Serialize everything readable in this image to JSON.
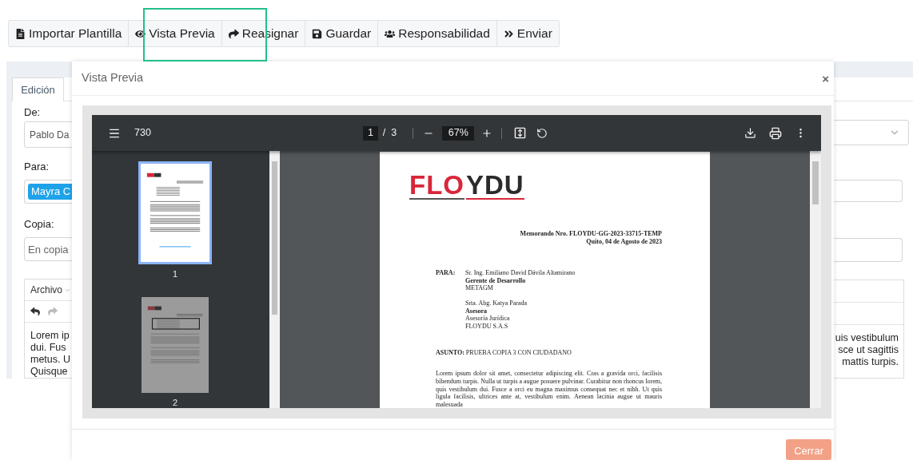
{
  "toolbar": {
    "buttons": [
      {
        "label": "Importar Plantilla"
      },
      {
        "label": "Vista Previa"
      },
      {
        "label": "Reasignar"
      },
      {
        "label": "Guardar"
      },
      {
        "label": "Responsabilidad"
      },
      {
        "label": "Enviar"
      }
    ]
  },
  "form": {
    "tab": {
      "label": "Edición",
      "selected": true
    },
    "from": {
      "label": "De:",
      "value": "Pablo Da"
    },
    "to": {
      "label": "Para:",
      "chip": "Mayra C"
    },
    "copy": {
      "label": "Copia:",
      "placeholder": "En copia"
    },
    "editor": {
      "menu": "Archivo",
      "text_left": [
        "Lorem ip",
        "dui. Fus",
        "metus. U",
        "Quisque"
      ],
      "text_right": [
        "uis vestibulum",
        "sce ut sagittis",
        "mattis turpis."
      ]
    }
  },
  "modal": {
    "title": "Vista Previa",
    "close": "×",
    "viewer": {
      "title": "730",
      "page": "1",
      "page_separator": "/",
      "page_count": "3",
      "zoom": "67%",
      "thumbnails": [
        {
          "label": "1",
          "selected": true
        },
        {
          "label": "2",
          "selected": false
        }
      ],
      "document": {
        "logo": [
          {
            "text": "FLO",
            "color": "#d9263a"
          },
          {
            "text": "YDU",
            "color": "#2b2b2b"
          }
        ],
        "memo_number": "Memorando Nro. FLOYDU-GG-2023-33715-TEMP",
        "date": "Quito, 04 de Agosto de 2023",
        "to_label": "PARA:",
        "recipients": [
          {
            "lines": [
              {
                "text": "Sr. Ing. Emiliano David Dávila Altamirano",
                "bold": false
              },
              {
                "text": "Gerente de Desarrollo",
                "bold": true
              },
              {
                "text": "METAGM",
                "bold": false
              }
            ]
          },
          {
            "lines": [
              {
                "text": "Srta. Abg. Katya Parada",
                "bold": false
              },
              {
                "text": "Asesora",
                "bold": true
              },
              {
                "text": "Asesoría Jurídica",
                "bold": false
              },
              {
                "text": "FLOYDU S.A.S",
                "bold": false
              }
            ]
          }
        ],
        "subject": "**ASUNTO:** PRUEBA COPIA 3 CON CIUDADANO",
        "body": "Lorem ipsum dolor sit amet, consectetur adipiscing elit. Cras a gravida orci, facilisis bibendum turpis. Nulla ut turpis a augue posuere pulvinar. Curabitur non rhoncus lorem, quis vestibulum dui. Fusce a orci eu magna maximus consequat nec et nibh. Ut quis ligula facilisis, ultrices ante at, vestibulum enim. Aenean lacinia augue ut mauris malesuada"
      }
    },
    "footer_button": "Cerrar"
  }
}
